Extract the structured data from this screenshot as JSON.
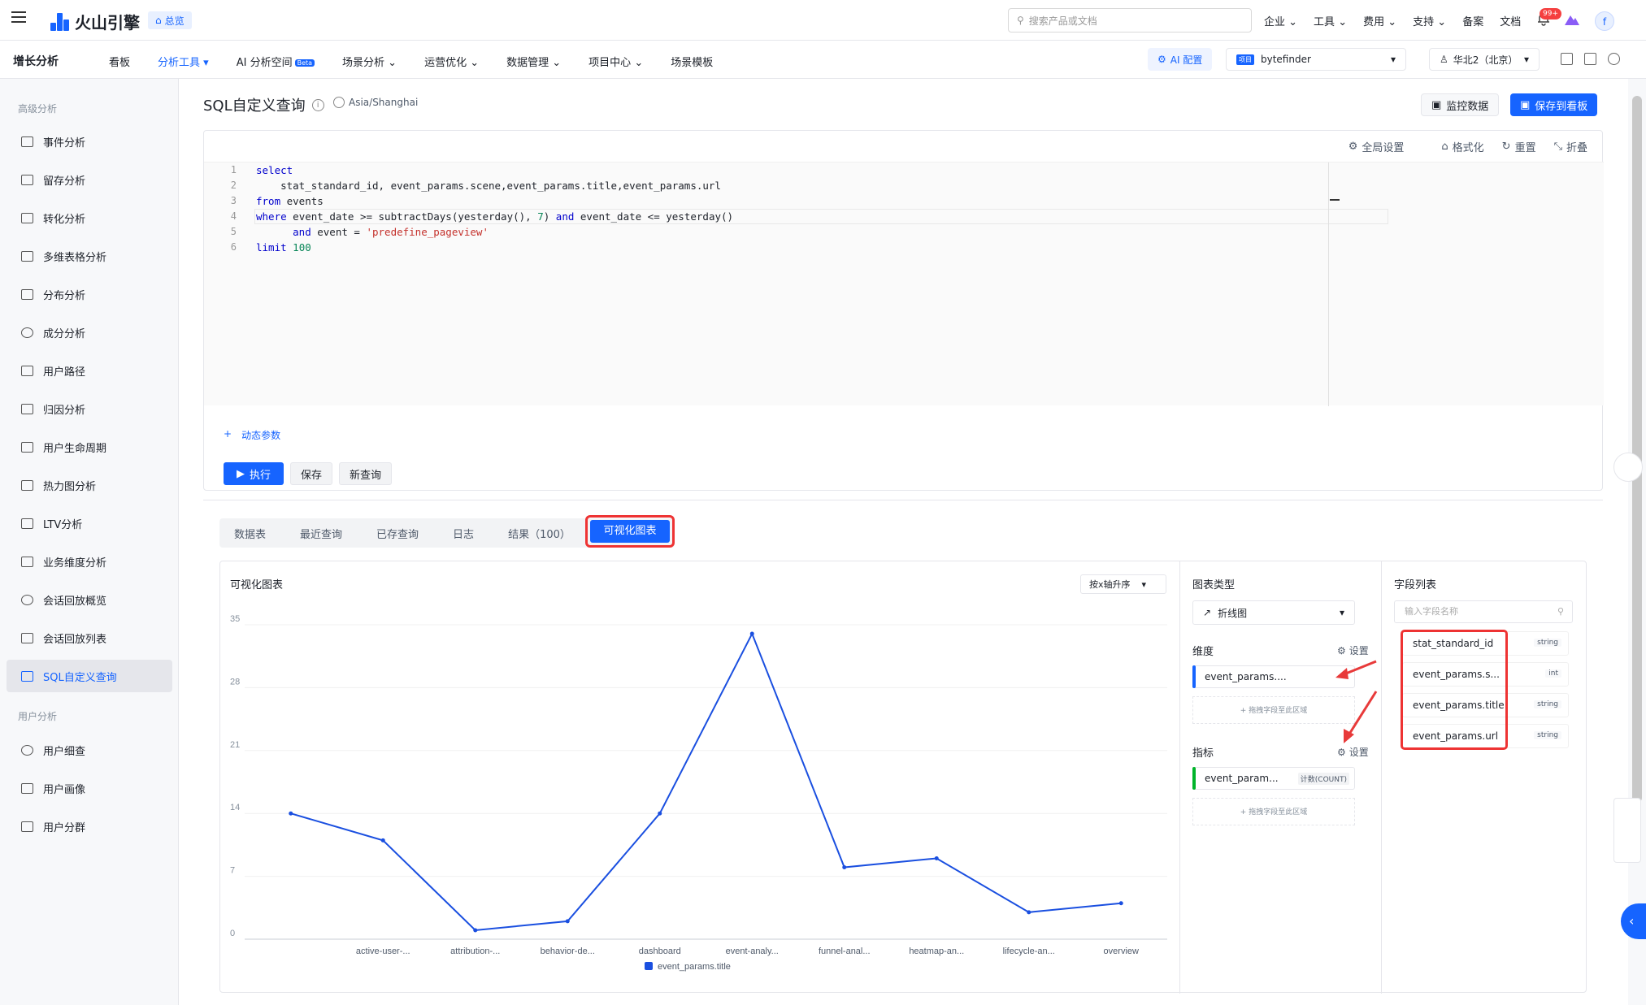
{
  "topbar": {
    "brand": "火山引擎",
    "home_chip": "总览",
    "search_placeholder": "搜索产品或文档",
    "nav": [
      "企业",
      "工具",
      "费用",
      "支持",
      "备案",
      "文档"
    ],
    "badge": "99+",
    "avatar": "f"
  },
  "secondbar": {
    "product": "增长分析",
    "menu": [
      "看板",
      "分析工具",
      "AI 分析空间",
      "场景分析",
      "运营优化",
      "数据管理",
      "项目中心",
      "场景模板"
    ],
    "beta": "Beta",
    "ai_config": "AI 配置",
    "project_tag": "项目",
    "project": "bytefinder",
    "region": "华北2（北京）"
  },
  "sidebar": {
    "group_advanced": "高级分析",
    "advanced_items": [
      "事件分析",
      "留存分析",
      "转化分析",
      "多维表格分析",
      "分布分析",
      "成分分析",
      "用户路径",
      "归因分析",
      "用户生命周期",
      "热力图分析",
      "LTV分析",
      "业务维度分析",
      "会话回放概览",
      "会话回放列表",
      "SQL自定义查询"
    ],
    "group_user": "用户分析",
    "user_items": [
      "用户细查",
      "用户画像",
      "用户分群"
    ]
  },
  "page": {
    "title": "SQL自定义查询",
    "timezone": "Asia/Shanghai",
    "monitor_btn": "监控数据",
    "save_board_btn": "保存到看板"
  },
  "editor": {
    "tools": [
      "全局设置",
      "格式化",
      "重置",
      "折叠"
    ],
    "line_numbers": [
      "1",
      "2",
      "3",
      "4",
      "5",
      "6"
    ],
    "code": {
      "l1_kw": "select",
      "l2": "    stat_standard_id, event_params.scene,event_params.title,event_params.url",
      "l3_kw": "from",
      "l3_rest": " events",
      "l4_kw": "where",
      "l4_a": " event_date >= subtractDays(yesterday(), ",
      "l4_num": "7",
      "l4_b": ") ",
      "l4_and": "and",
      "l4_c": " event_date <= yesterday()",
      "l5_pre": "      ",
      "l5_and": "and",
      "l5_mid": " event = ",
      "l5_str": "'predefine_pageview'",
      "l6_kw": "limit",
      "l6_num": " 100"
    },
    "dynamic_params": "动态参数",
    "run": "执行",
    "save": "保存",
    "new_query": "新查询"
  },
  "result_tabs": [
    "数据表",
    "最近查询",
    "已存查询",
    "日志",
    "结果（100）",
    "可视化图表"
  ],
  "vis": {
    "chart_title": "可视化图表",
    "sort": "按x轴升序",
    "chart_type_label": "图表类型",
    "chart_type": "折线图",
    "dimension_label": "维度",
    "settings": "设置",
    "dimension_field": "event_params....",
    "drop_hint": "+ 拖拽字段至此区域",
    "metric_label": "指标",
    "metric_field": "event_param...",
    "metric_agg": "计数(COUNT)",
    "field_list_label": "字段列表",
    "field_search_placeholder": "输入字段名称",
    "fields": [
      {
        "name": "stat_standard_id",
        "type": "string"
      },
      {
        "name": "event_params.s...",
        "type": "int"
      },
      {
        "name": "event_params.title",
        "type": "string"
      },
      {
        "name": "event_params.url",
        "type": "string"
      }
    ]
  },
  "chart_data": {
    "type": "line",
    "categories": [
      "",
      "active-user-...",
      "attribution-...",
      "behavior-de...",
      "dashboard",
      "event-analy...",
      "funnel-anal...",
      "heatmap-an...",
      "lifecycle-an...",
      "overview"
    ],
    "series": [
      {
        "name": "event_params.title",
        "values": [
          14,
          11,
          1,
          2,
          14,
          34,
          8,
          9,
          3,
          4
        ]
      }
    ],
    "yticks": [
      0,
      7,
      14,
      21,
      28,
      35
    ],
    "ylim": [
      0,
      35
    ],
    "legend": "bottom-center",
    "line_color": "#1a4fe0"
  }
}
